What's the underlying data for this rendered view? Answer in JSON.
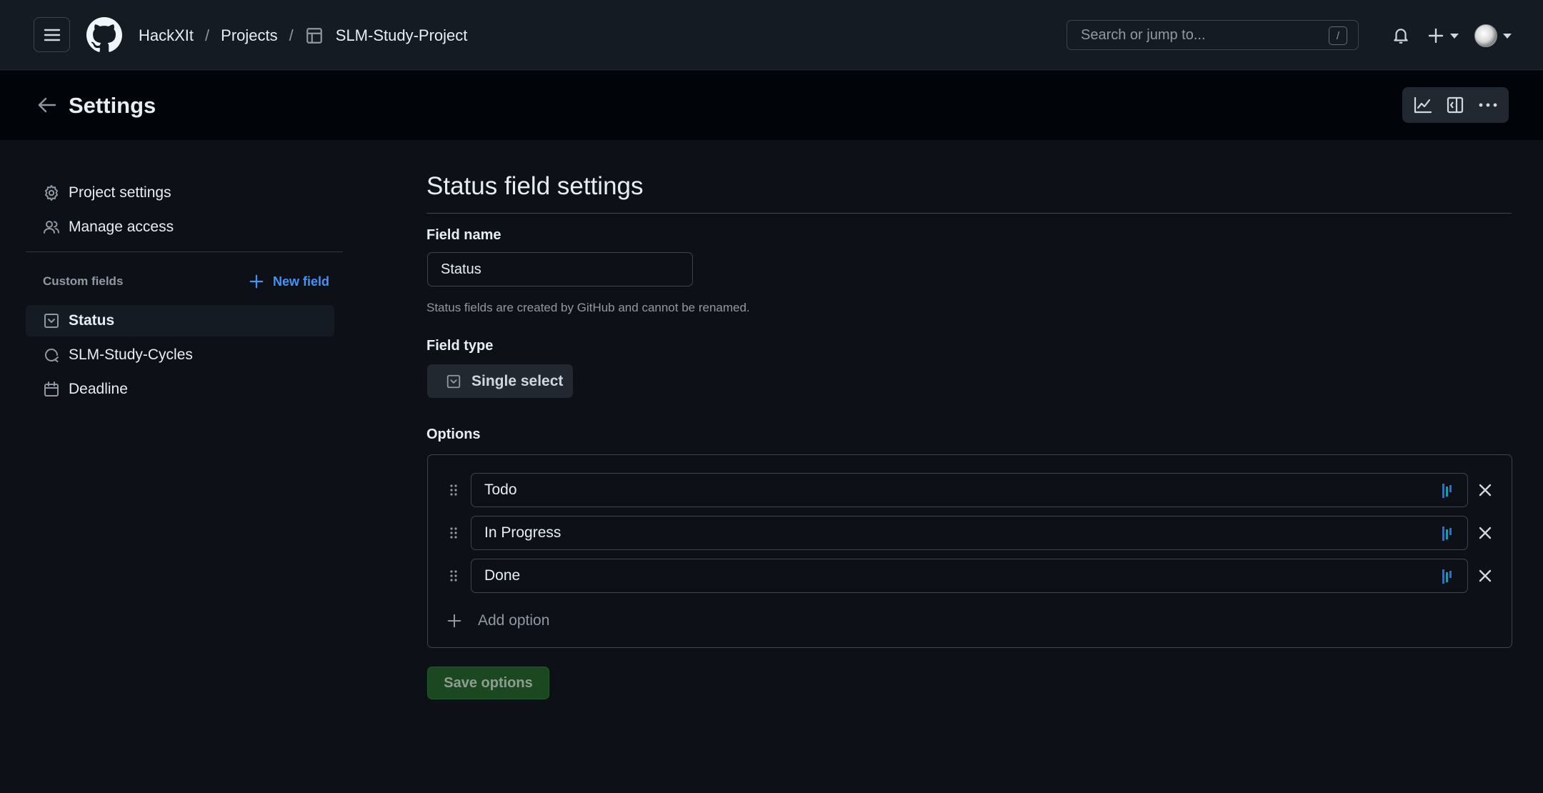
{
  "header": {
    "breadcrumbs": [
      "HackXIt",
      "Projects",
      "SLM-Study-Project"
    ],
    "separator": "/",
    "search_placeholder": "Search or jump to...",
    "search_shortcut": "/"
  },
  "settings_bar": {
    "title": "Settings"
  },
  "sidebar": {
    "items": [
      {
        "label": "Project settings",
        "icon": "gear-icon"
      },
      {
        "label": "Manage access",
        "icon": "people-icon"
      }
    ],
    "custom_fields_label": "Custom fields",
    "new_field_label": "New field",
    "fields": [
      {
        "label": "Status",
        "icon": "single-select-icon",
        "active": true
      },
      {
        "label": "SLM-Study-Cycles",
        "icon": "iteration-icon",
        "active": false
      },
      {
        "label": "Deadline",
        "icon": "calendar-icon",
        "active": false
      }
    ]
  },
  "main": {
    "title": "Status field settings",
    "field_name_label": "Field name",
    "field_name_value": "Status",
    "field_name_hint": "Status fields are created by GitHub and cannot be renamed.",
    "field_type_label": "Field type",
    "field_type_value": "Single select",
    "options_label": "Options",
    "options": [
      "Todo",
      "In Progress",
      "Done"
    ],
    "add_option_label": "Add option",
    "save_label": "Save options"
  },
  "colors": {
    "accent": "#4493f8",
    "active_bar": "#1f6feb",
    "save_button": "#1b4721"
  }
}
